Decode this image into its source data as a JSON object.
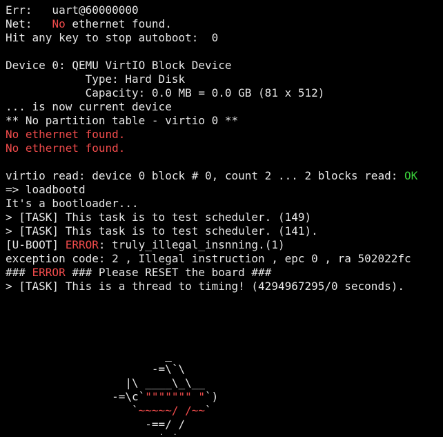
{
  "colors": {
    "background": "#000000",
    "text": "#e6e6e6",
    "error_red": "#f04b4b",
    "ok_green": "#3ad13a"
  },
  "terminal": {
    "lines": [
      {
        "segments": [
          {
            "text": "Err:   uart@60000000"
          }
        ]
      },
      {
        "segments": [
          {
            "text": "Net:   "
          },
          {
            "text": "No",
            "color": "red"
          },
          {
            "text": " ethernet found."
          }
        ]
      },
      {
        "segments": [
          {
            "text": "Hit any key to stop autoboot:  0"
          }
        ]
      },
      {
        "segments": [
          {
            "text": ""
          }
        ]
      },
      {
        "segments": [
          {
            "text": "Device 0: QEMU VirtIO Block Device"
          }
        ]
      },
      {
        "segments": [
          {
            "text": "            Type: Hard Disk"
          }
        ]
      },
      {
        "segments": [
          {
            "text": "            Capacity: 0.0 MB = 0.0 GB (81 x 512)"
          }
        ]
      },
      {
        "segments": [
          {
            "text": "... is now current device"
          }
        ]
      },
      {
        "segments": [
          {
            "text": "** No partition table - virtio 0 **"
          }
        ]
      },
      {
        "segments": [
          {
            "text": "No ethernet found.",
            "color": "red"
          }
        ]
      },
      {
        "segments": [
          {
            "text": "No ethernet found.",
            "color": "red"
          }
        ]
      },
      {
        "segments": [
          {
            "text": ""
          }
        ]
      },
      {
        "segments": [
          {
            "text": "virtio read: device 0 block # 0, count 2 ... 2 blocks read: "
          },
          {
            "text": "OK",
            "color": "green"
          }
        ]
      },
      {
        "segments": [
          {
            "text": "=> loadbootd"
          }
        ]
      },
      {
        "segments": [
          {
            "text": "It's a bootloader..."
          }
        ]
      },
      {
        "segments": [
          {
            "text": "> [TASK] This task is to test scheduler. (149)"
          }
        ]
      },
      {
        "segments": [
          {
            "text": "> [TASK] This task is to test scheduler. (141)."
          }
        ]
      },
      {
        "segments": [
          {
            "text": "[U-BOOT] "
          },
          {
            "text": "ERROR",
            "color": "red"
          },
          {
            "text": ": truly_illegal_insnning.(1)"
          }
        ]
      },
      {
        "segments": [
          {
            "text": "exception code: 2 , Illegal instruction , epc 0 , ra 502022fc"
          }
        ]
      },
      {
        "segments": [
          {
            "text": "### "
          },
          {
            "text": "ERROR",
            "color": "red"
          },
          {
            "text": " ### Please RESET the board ###"
          }
        ]
      },
      {
        "segments": [
          {
            "text": "> [TASK] This is a thread to timing! (4294967295/0 seconds)."
          }
        ]
      },
      {
        "segments": [
          {
            "text": ""
          }
        ]
      },
      {
        "segments": [
          {
            "text": ""
          }
        ]
      },
      {
        "segments": [
          {
            "text": ""
          }
        ]
      },
      {
        "segments": [
          {
            "text": ""
          }
        ]
      },
      {
        "segments": [
          {
            "text": "                        _"
          }
        ]
      },
      {
        "segments": [
          {
            "text": "                      -=\\`\\"
          }
        ]
      },
      {
        "segments": [
          {
            "text": "                  |\\ ____\\_\\__"
          }
        ]
      },
      {
        "segments": [
          {
            "text": "                -=\\c`"
          },
          {
            "text": "\"\"\"\"\"\"\" \"",
            "color": "red"
          },
          {
            "text": "`)"
          }
        ]
      },
      {
        "segments": [
          {
            "text": "                   `"
          },
          {
            "text": "~~~~~/ /~~",
            "color": "red"
          },
          {
            "text": "`"
          }
        ]
      },
      {
        "segments": [
          {
            "text": "                     -==/ /"
          }
        ]
      },
      {
        "segments": [
          {
            "text": "                       '-'"
          }
        ]
      }
    ]
  }
}
